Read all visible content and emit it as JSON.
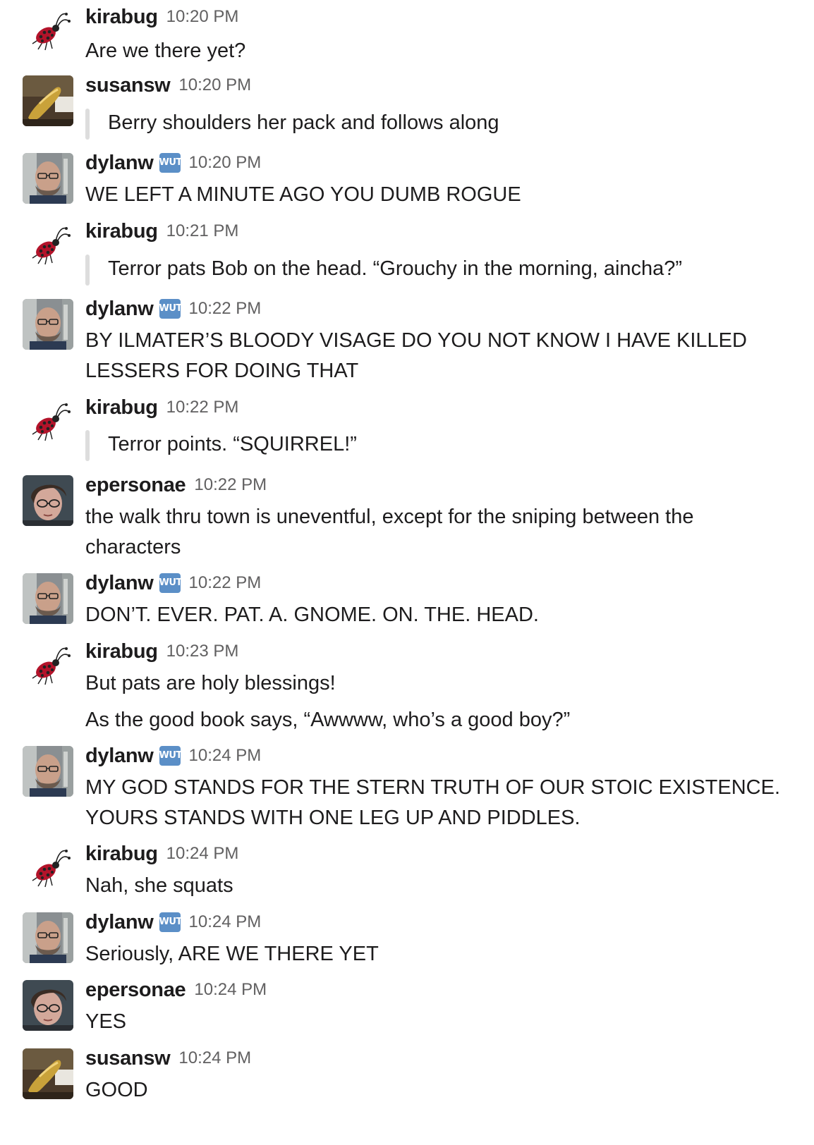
{
  "badge_text": "WUT",
  "messages": [
    {
      "user": "kirabug",
      "time": "10:20 PM",
      "lines": [
        "Are we there yet?"
      ]
    },
    {
      "user": "susansw",
      "time": "10:20 PM",
      "quote": "Berry shoulders her pack and follows along"
    },
    {
      "user": "dylanw",
      "time": "10:20 PM",
      "lines": [
        "WE LEFT A MINUTE AGO YOU DUMB ROGUE"
      ]
    },
    {
      "user": "kirabug",
      "time": "10:21 PM",
      "quote": "Terror pats Bob on the head. “Grouchy in the morning, aincha?”"
    },
    {
      "user": "dylanw",
      "time": "10:22 PM",
      "lines": [
        "BY ILMATER’S BLOODY VISAGE DO YOU NOT KNOW I HAVE KILLED",
        "LESSERS FOR DOING THAT"
      ]
    },
    {
      "user": "kirabug",
      "time": "10:22 PM",
      "quote": "Terror points. “SQUIRREL!”"
    },
    {
      "user": "epersonae",
      "time": "10:22 PM",
      "lines": [
        "the walk thru town is uneventful, except for the sniping between the",
        "characters"
      ]
    },
    {
      "user": "dylanw",
      "time": "10:22 PM",
      "lines": [
        "DON’T. EVER. PAT. A. GNOME. ON. THE. HEAD."
      ]
    },
    {
      "user": "kirabug",
      "time": "10:23 PM",
      "lines": [
        "But pats are holy blessings!"
      ],
      "extra": "As the good book says, “Awwww, who’s a good boy?”"
    },
    {
      "user": "dylanw",
      "time": "10:24 PM",
      "lines": [
        "MY GOD STANDS FOR THE STERN TRUTH OF OUR STOIC EXISTENCE.",
        "YOURS STANDS WITH ONE LEG UP AND PIDDLES."
      ]
    },
    {
      "user": "kirabug",
      "time": "10:24 PM",
      "lines": [
        "Nah, she squats"
      ]
    },
    {
      "user": "dylanw",
      "time": "10:24 PM",
      "lines": [
        "Seriously, ARE WE THERE YET"
      ]
    },
    {
      "user": "epersonae",
      "time": "10:24 PM",
      "lines": [
        "YES"
      ]
    },
    {
      "user": "susansw",
      "time": "10:24 PM",
      "lines": [
        "GOOD"
      ]
    }
  ]
}
